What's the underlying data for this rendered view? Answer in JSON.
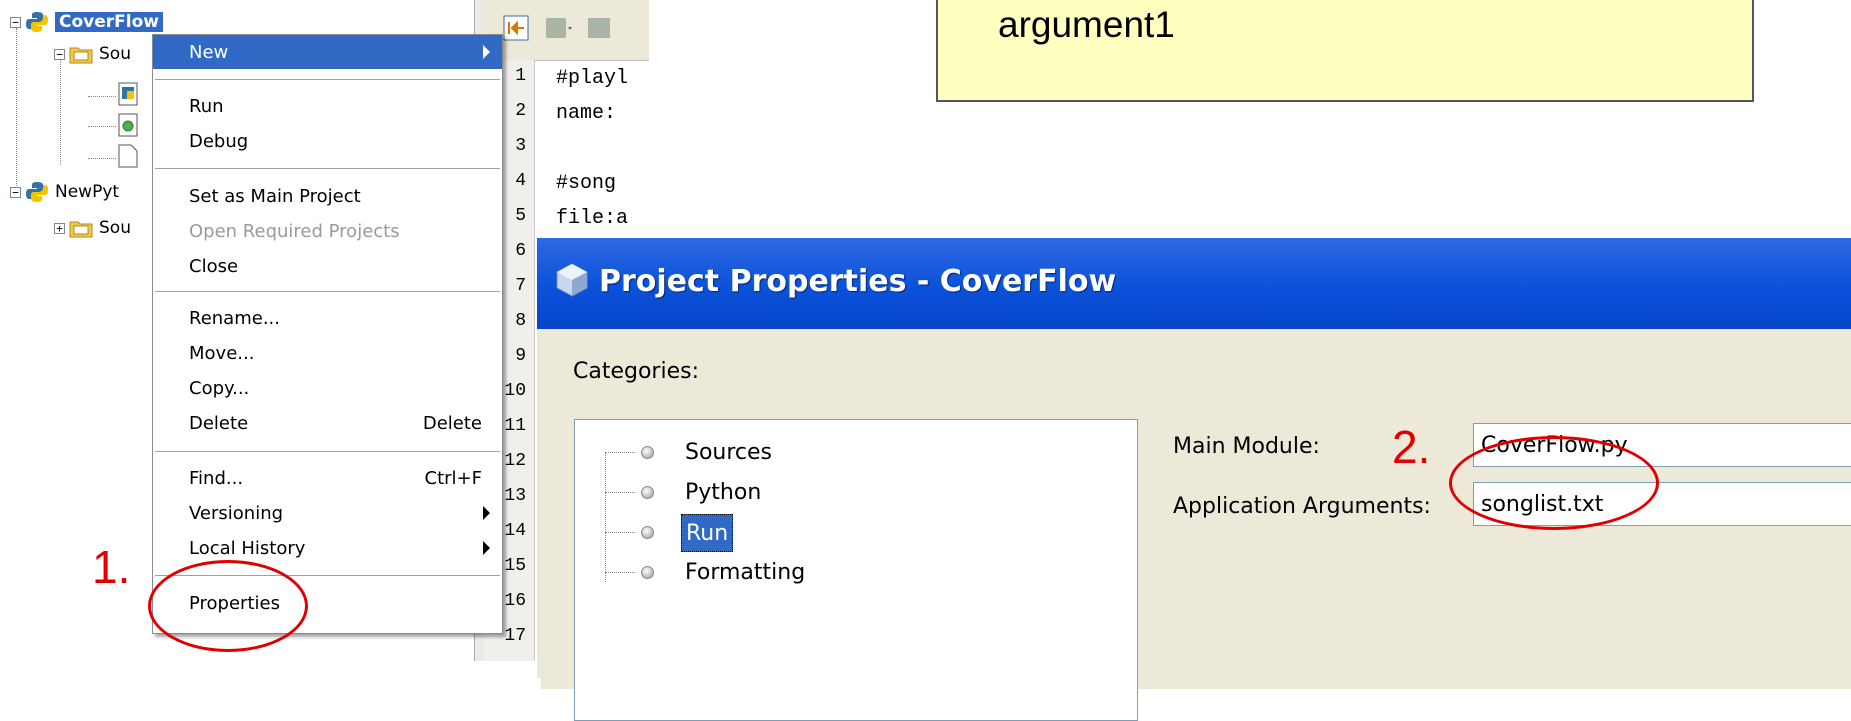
{
  "tree": {
    "items": [
      {
        "label": "CoverFlow"
      },
      {
        "label": "Sou"
      },
      {
        "label": "NewPyt"
      },
      {
        "label": "Sou"
      }
    ]
  },
  "menu": {
    "items": [
      {
        "label": "New",
        "accel": ""
      },
      {
        "label": "Run",
        "accel": ""
      },
      {
        "label": "Debug",
        "accel": ""
      },
      {
        "label": "Set as Main Project",
        "accel": ""
      },
      {
        "label": "Open Required Projects",
        "accel": ""
      },
      {
        "label": "Close",
        "accel": ""
      },
      {
        "label": "Rename...",
        "accel": ""
      },
      {
        "label": "Move...",
        "accel": ""
      },
      {
        "label": "Copy...",
        "accel": ""
      },
      {
        "label": "Delete",
        "accel": "Delete"
      },
      {
        "label": "Find...",
        "accel": "Ctrl+F"
      },
      {
        "label": "Versioning",
        "accel": ""
      },
      {
        "label": "Local History",
        "accel": ""
      },
      {
        "label": "Properties",
        "accel": ""
      }
    ]
  },
  "editor": {
    "lines": [
      {
        "no": "1",
        "text": "#playl"
      },
      {
        "no": "2",
        "text": "name:"
      },
      {
        "no": "3",
        "text": ""
      },
      {
        "no": "4",
        "text": "#song"
      },
      {
        "no": "5",
        "text": "file:a"
      },
      {
        "no": "6",
        "text": ""
      },
      {
        "no": "7",
        "text": ""
      },
      {
        "no": "8",
        "text": ""
      },
      {
        "no": "9",
        "text": ""
      },
      {
        "no": "10",
        "text": ""
      },
      {
        "no": "11",
        "text": ""
      },
      {
        "no": "12",
        "text": ""
      },
      {
        "no": "13",
        "text": ""
      },
      {
        "no": "14",
        "text": ""
      },
      {
        "no": "15",
        "text": ""
      },
      {
        "no": "16",
        "text": ""
      },
      {
        "no": "17",
        "text": ""
      }
    ]
  },
  "note": {
    "text": "argument1"
  },
  "dialog": {
    "title": "Project Properties - CoverFlow",
    "categories_label": "Categories:",
    "categories": [
      "Sources",
      "Python",
      "Run",
      "Formatting"
    ],
    "selected_category": "Run",
    "main_module_label": "Main Module:",
    "main_module_value": "CoverFlow.py",
    "app_args_label": "Application Arguments:",
    "app_args_value": "songlist.txt"
  },
  "annotations": {
    "step1": "1.",
    "step2": "2."
  },
  "colors": {
    "selection": "#316ac5",
    "titlebar": "#0a52da",
    "annotation": "#e00000",
    "note_bg": "#ffffc0"
  }
}
